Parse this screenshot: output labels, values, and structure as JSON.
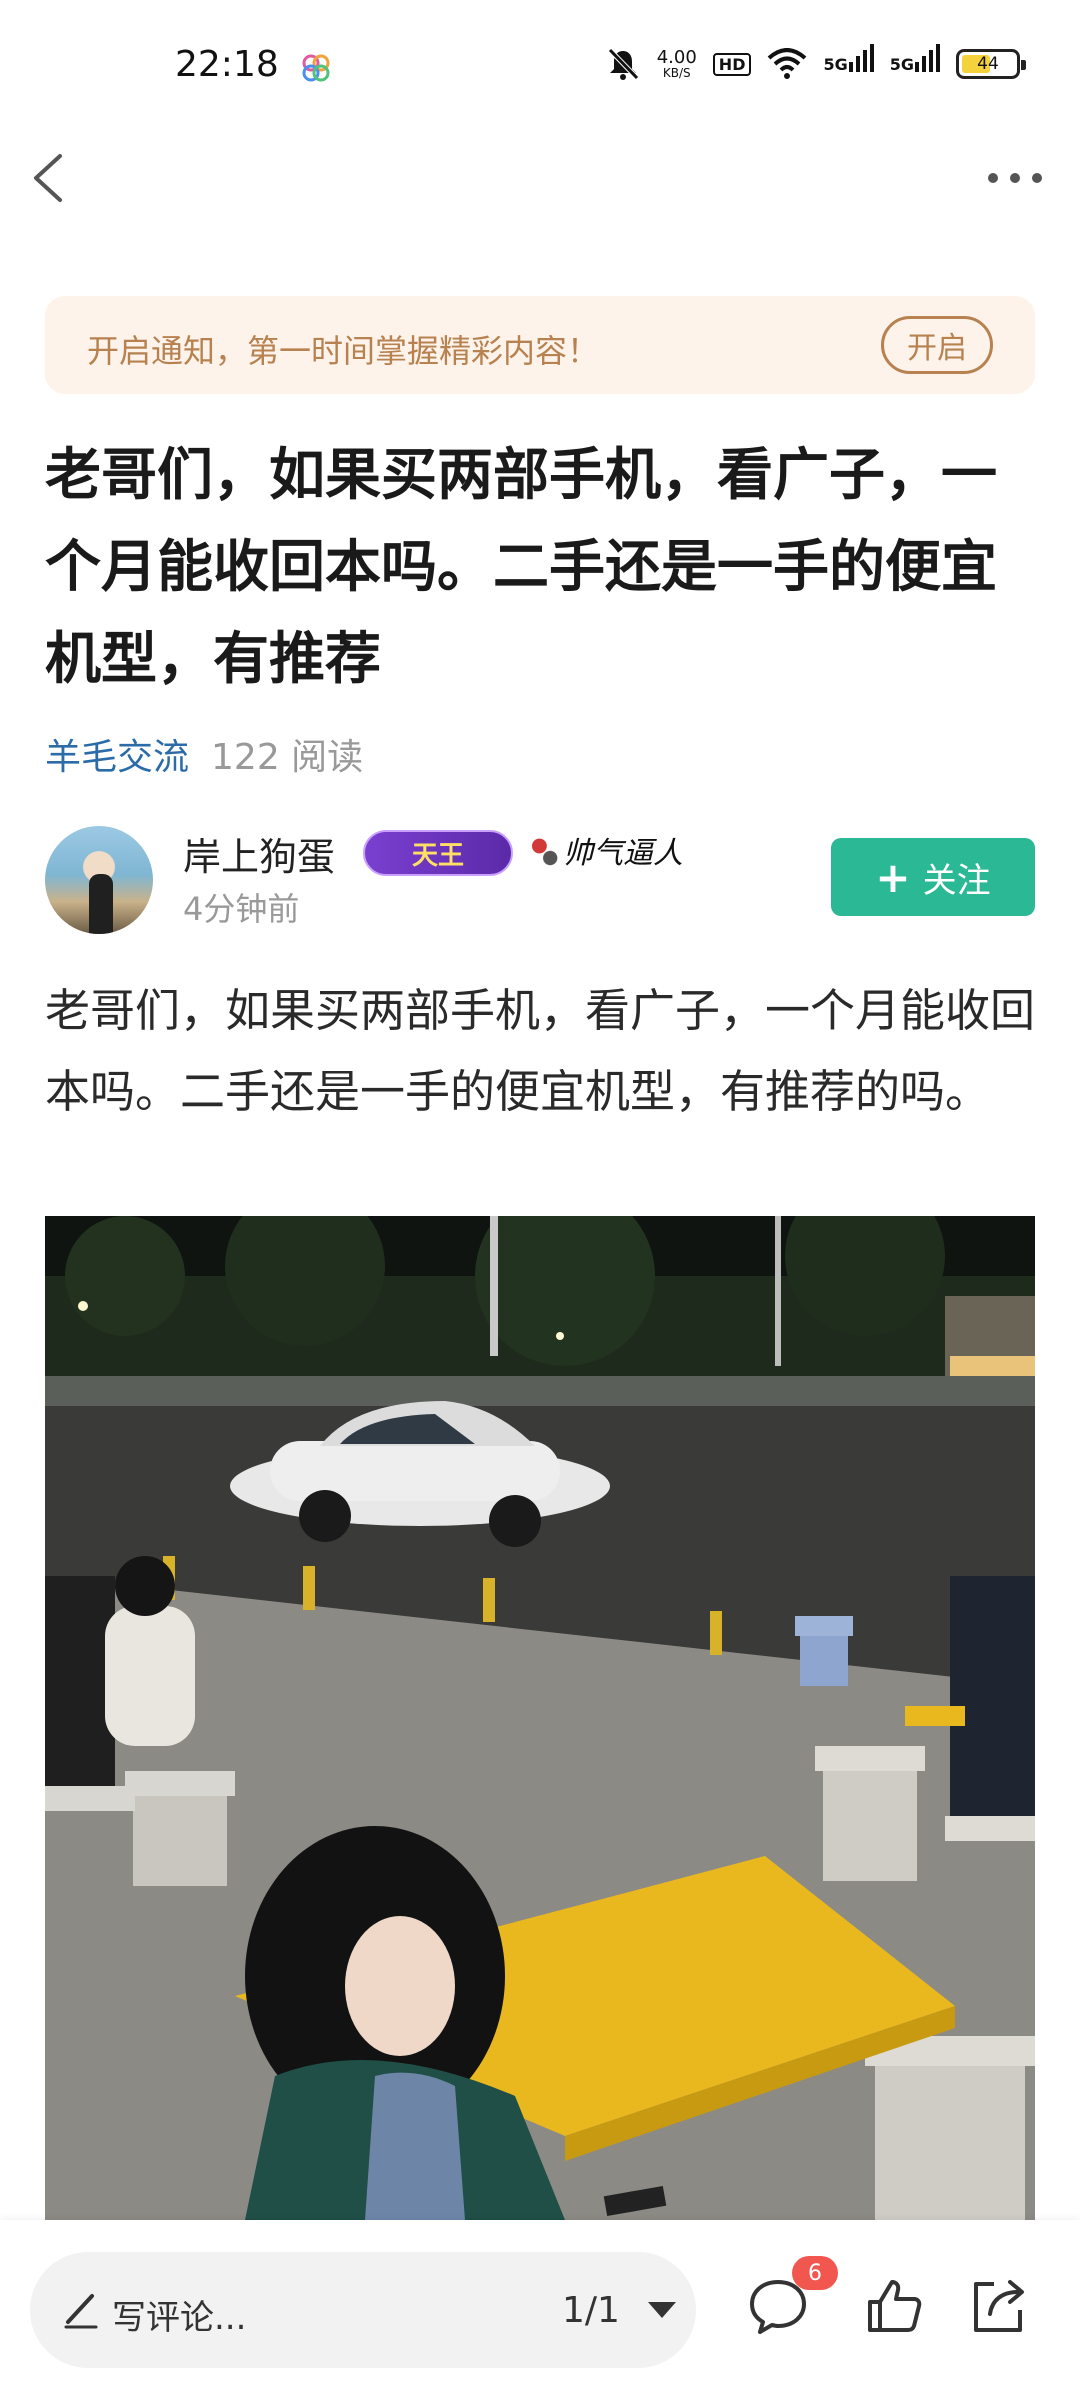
{
  "status_bar": {
    "time": "22:18",
    "net_speed_value": "4.00",
    "net_speed_unit": "KB/S",
    "hd_label": "HD",
    "signal1_label": "5G",
    "signal2_label": "5G",
    "battery_level": "44"
  },
  "notice": {
    "text": "开启通知，第一时间掌握精彩内容！",
    "button_label": "开启"
  },
  "post": {
    "title": "老哥们，如果买两部手机，看广子，一个月能收回本吗。二手还是一手的便宜机型，有推荐",
    "category": "羊毛交流",
    "read_count": "122 阅读",
    "body": "老哥们，如果买两部手机，看广子，一个月能收回本吗。二手还是一手的便宜机型，有推荐的吗。"
  },
  "author": {
    "name": "岸上狗蛋",
    "badge_title": "天王",
    "badge_signature": "帅气逼人",
    "time_ago": "4分钟前",
    "follow_label": "关注",
    "follow_plus": "+"
  },
  "bottom_bar": {
    "comment_placeholder": "写评论...",
    "page_indicator": "1/1",
    "comment_count": "6"
  },
  "colors": {
    "follow_green": "#2bb894",
    "category_blue": "#2a6ba8",
    "notice_brown": "#b88250",
    "badge_red": "#f2574f"
  },
  "icons": [
    "back-icon",
    "more-icon",
    "mute-icon",
    "wifi-icon",
    "battery-icon",
    "pen-icon",
    "caret-down-icon",
    "comment-icon",
    "like-icon",
    "share-icon"
  ]
}
